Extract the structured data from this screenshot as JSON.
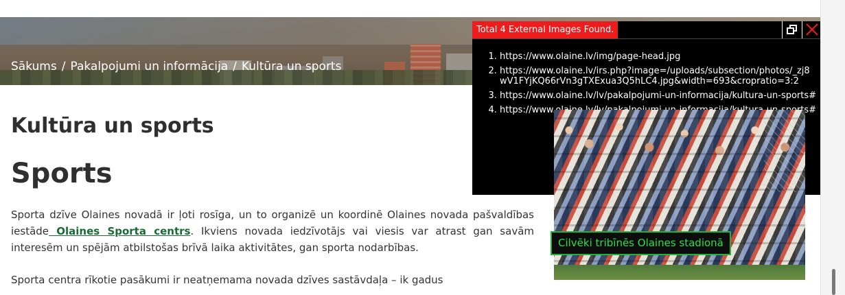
{
  "hero": {
    "breadcrumb": {
      "home": "Sākums",
      "parent": "Pakalpojumi un informācija",
      "current": "Kultūra un sports",
      "separator": "/"
    }
  },
  "content": {
    "page_title": "Kultūra un sports",
    "section_title": "Sports",
    "paragraph1": {
      "before_link": "Sporta dzīve Olaines novadā ir ļoti rosīga, un to organizē un koordinē Olaines novada pašvaldības iestāde",
      "link_text": " Olaines Sporta centrs",
      "after_link": ". Ikviens novada iedzīvotājs vai viesis var atrast gan savām interesēm un spējām atbilstošas brīvā laika aktivitātes, gan sporta nodarbības."
    },
    "paragraph2": "Sporta centra rīkotie pasākumi ir neatņemama novada dzīves sastāvdaļa – ik gadus"
  },
  "photo": {
    "caption": "Cilvēki tribīnēs Olaines stadionā"
  },
  "overlay": {
    "title": "Total 4 External Images Found.",
    "urls": [
      "https://www.olaine.lv/img/page-head.jpg",
      "https://www.olaine.lv/irs.php?image=/uploads/subsection/photos/_zj8wV1FYjKQ66rVn3gTXExua3Q5hLC4.jpg&width=693&cropratio=3:2",
      "https://www.olaine.lv/lv/pakalpojumi-un-informacija/kultura-un-sports#",
      "https://www.olaine.lv/lv/pakalpojumi-un-informacija/kultura-un-sports#"
    ]
  },
  "colors": {
    "overlay_title_bg": "#ee1c1c",
    "caption_text": "#22e247",
    "caption_border": "#1fb33a",
    "link": "#1a6a36"
  },
  "icons": {
    "restore": "restore-window-icon",
    "close": "close-icon"
  }
}
